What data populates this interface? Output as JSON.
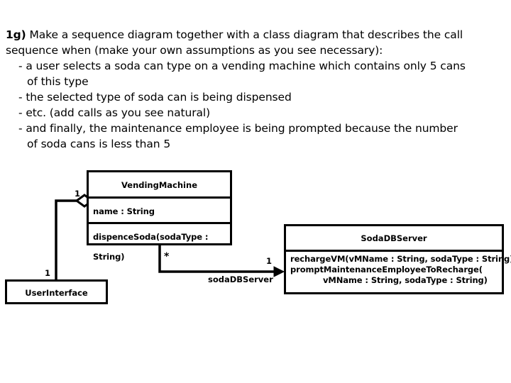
{
  "prompt": {
    "question_label": "1g)",
    "lines": [
      {
        "text": " Make a sequence diagram together with a class diagram that describes the call",
        "indent": 0,
        "with_label": true
      },
      {
        "text": "sequence when (make your own assumptions as you see necessary):",
        "indent": 0,
        "with_label": false
      },
      {
        "text": "- a user selects a soda can type on a vending machine which contains only 5 cans",
        "indent": 1,
        "with_label": false
      },
      {
        "text": "of this type",
        "indent": 2,
        "with_label": false
      },
      {
        "text": "- the selected type of soda can is being dispensed",
        "indent": 1,
        "with_label": false
      },
      {
        "text": "- etc. (add calls as you see natural)",
        "indent": 1,
        "with_label": false
      },
      {
        "text": "- and finally, the maintenance employee is being prompted because the number",
        "indent": 1,
        "with_label": false
      },
      {
        "text": "of soda cans is less than 5",
        "indent": 2,
        "with_label": false
      }
    ]
  },
  "diagram": {
    "type": "uml-class-diagram",
    "classes": {
      "vending_machine": {
        "name": "VendingMachine",
        "attributes": [
          "name : String"
        ],
        "operations": [
          "dispenceSoda(sodaType : String)"
        ]
      },
      "soda_db_server": {
        "name": "SodaDBServer",
        "operations": [
          "rechargeVM(vMName : String, sodaType : String)",
          "promptMaintenanceEmployeeToRecharge(",
          "vMName : String, sodaType : String)"
        ]
      },
      "user_interface": {
        "name": "UserInterface"
      }
    },
    "relationships": {
      "ui_to_vm": {
        "kind": "aggregation",
        "source_multiplicity": "1",
        "target_multiplicity": "1"
      },
      "vm_to_db": {
        "kind": "directed-association",
        "source_multiplicity": "*",
        "target_multiplicity": "1",
        "role_name": "sodaDBServer"
      }
    },
    "colors": {
      "stroke": "#000000",
      "fill": "#ffffff",
      "text": "#000000"
    }
  }
}
